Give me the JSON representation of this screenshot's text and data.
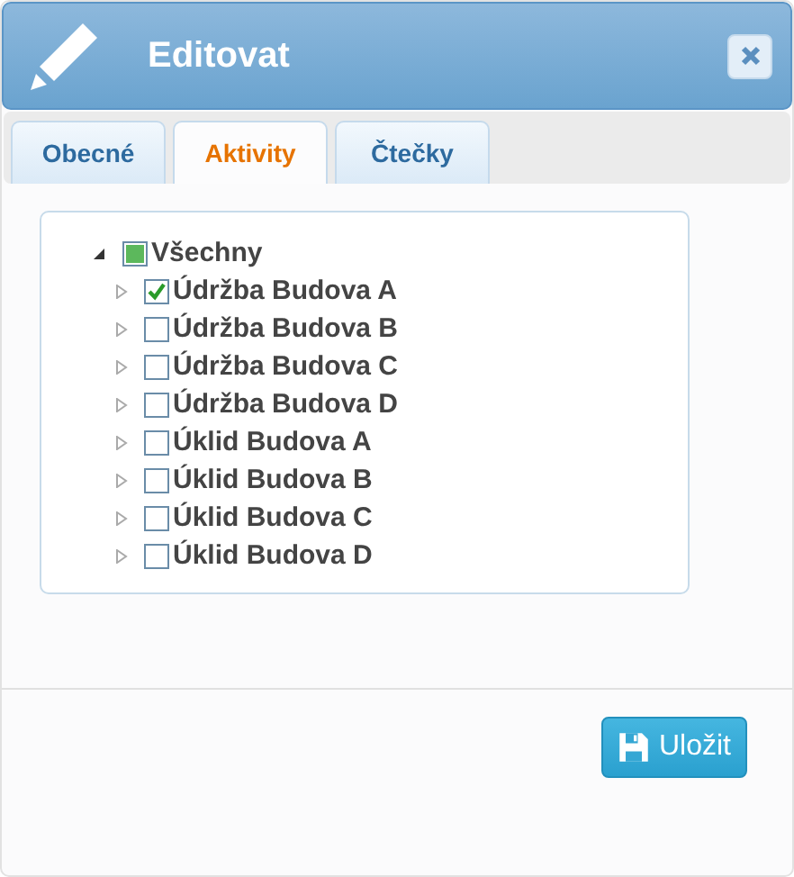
{
  "window": {
    "title": "Editovat"
  },
  "tabs": [
    {
      "label": "Obecné",
      "selected": false
    },
    {
      "label": "Aktivity",
      "selected": true
    },
    {
      "label": "Čtečky",
      "selected": false
    }
  ],
  "tree": {
    "label": "Všechny",
    "expanded": true,
    "checked": false,
    "indeterminate": true,
    "children": [
      {
        "label": "Údržba Budova A",
        "expanded": false,
        "checked": true
      },
      {
        "label": "Údržba Budova B",
        "expanded": false,
        "checked": false
      },
      {
        "label": "Údržba Budova C",
        "expanded": false,
        "checked": false
      },
      {
        "label": "Údržba Budova D",
        "expanded": false,
        "checked": false
      },
      {
        "label": "Úklid Budova A",
        "expanded": false,
        "checked": false
      },
      {
        "label": "Úklid Budova B",
        "expanded": false,
        "checked": false
      },
      {
        "label": "Úklid Budova C",
        "expanded": false,
        "checked": false
      },
      {
        "label": "Úklid Budova D",
        "expanded": false,
        "checked": false
      }
    ]
  },
  "save_button": "Uložit"
}
